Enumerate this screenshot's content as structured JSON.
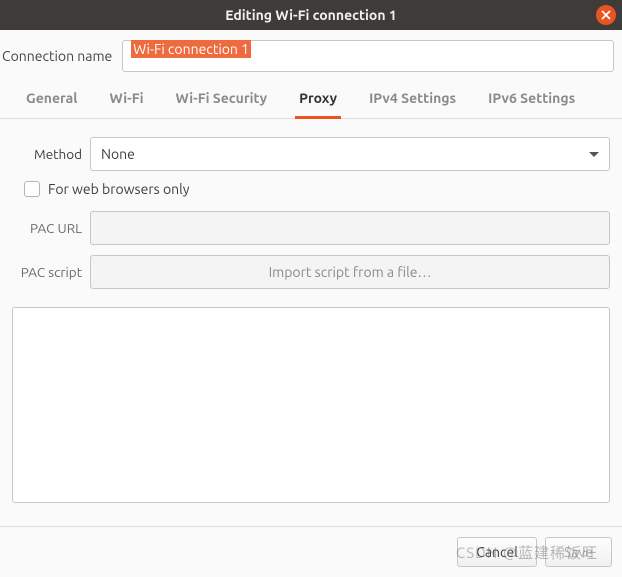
{
  "window": {
    "title": "Editing Wi-Fi connection 1"
  },
  "name": {
    "label": "Connection name",
    "value": "Wi-Fi connection 1"
  },
  "tabs": {
    "general": "General",
    "wifi": "Wi-Fi",
    "security": "Wi-Fi Security",
    "proxy": "Proxy",
    "ipv4": "IPv4 Settings",
    "ipv6": "IPv6 Settings",
    "active": "proxy"
  },
  "proxy": {
    "method_label": "Method",
    "method_value": "None",
    "browsers_only_label": "For web browsers only",
    "browsers_only_checked": false,
    "pac_url_label": "PAC URL",
    "pac_url_value": "",
    "pac_script_label": "PAC script",
    "import_label": "Import script from a file…"
  },
  "buttons": {
    "cancel": "Cancel",
    "save": "Save"
  },
  "watermark": "CSDN @蓝建稀饭旺"
}
